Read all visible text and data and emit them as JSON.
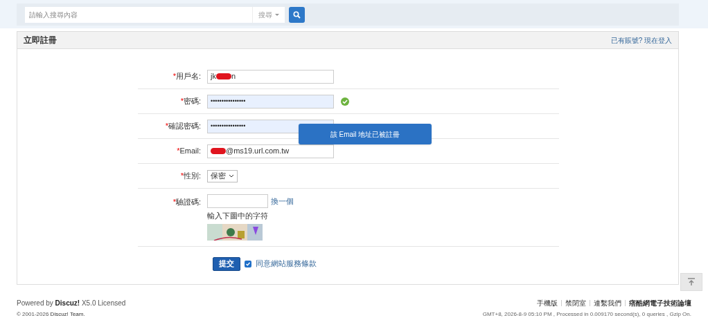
{
  "search": {
    "placeholder": "請輸入搜尋內容",
    "scope": "搜尋"
  },
  "panel": {
    "title": "立即註冊",
    "login_link": "已有賬號? 現在登入"
  },
  "fields": [
    {
      "kind": "text",
      "required": "*",
      "label": "用戶名:",
      "value_before": "jk",
      "redacted": true,
      "value_after": "n",
      "valid": false
    },
    {
      "kind": "password",
      "required": "*",
      "label": "密碼:",
      "value": "••••••••••••••••",
      "valid": true
    },
    {
      "kind": "password",
      "required": "*",
      "label": "確認密碼:",
      "value": "••••••••••••••••",
      "valid": false
    },
    {
      "kind": "text",
      "required": "*",
      "label": "Email:",
      "redacted": true,
      "value_after": "@ms19.url.com.tw",
      "valid": false
    },
    {
      "kind": "select",
      "required": "*",
      "label": "性別:",
      "value": "保密"
    },
    {
      "kind": "captcha",
      "required": "*",
      "label": "驗證碼:",
      "refresh": "換一個",
      "hint": "輸入下圖中的字符"
    }
  ],
  "tooltip": "該 Email 地址已被註冊",
  "submit": "提交",
  "agree": {
    "label": "同意網站服務條款",
    "checked": true
  },
  "footer": {
    "powered_prefix": "Powered by",
    "powered_brand": "Discuz!",
    "powered_suffix": "X5.0 Licensed",
    "copyright_prefix": "© 2001-2026",
    "copyright_team": "Discuz! Team.",
    "links": [
      "手機版",
      "禁閉室",
      "連繫我們"
    ],
    "site": "痞酷網電子技術論壇",
    "stats": "GMT+8, 2026-8-9 05:10 PM , Processed in 0.009170 second(s), 0 queries , Gzip On."
  }
}
